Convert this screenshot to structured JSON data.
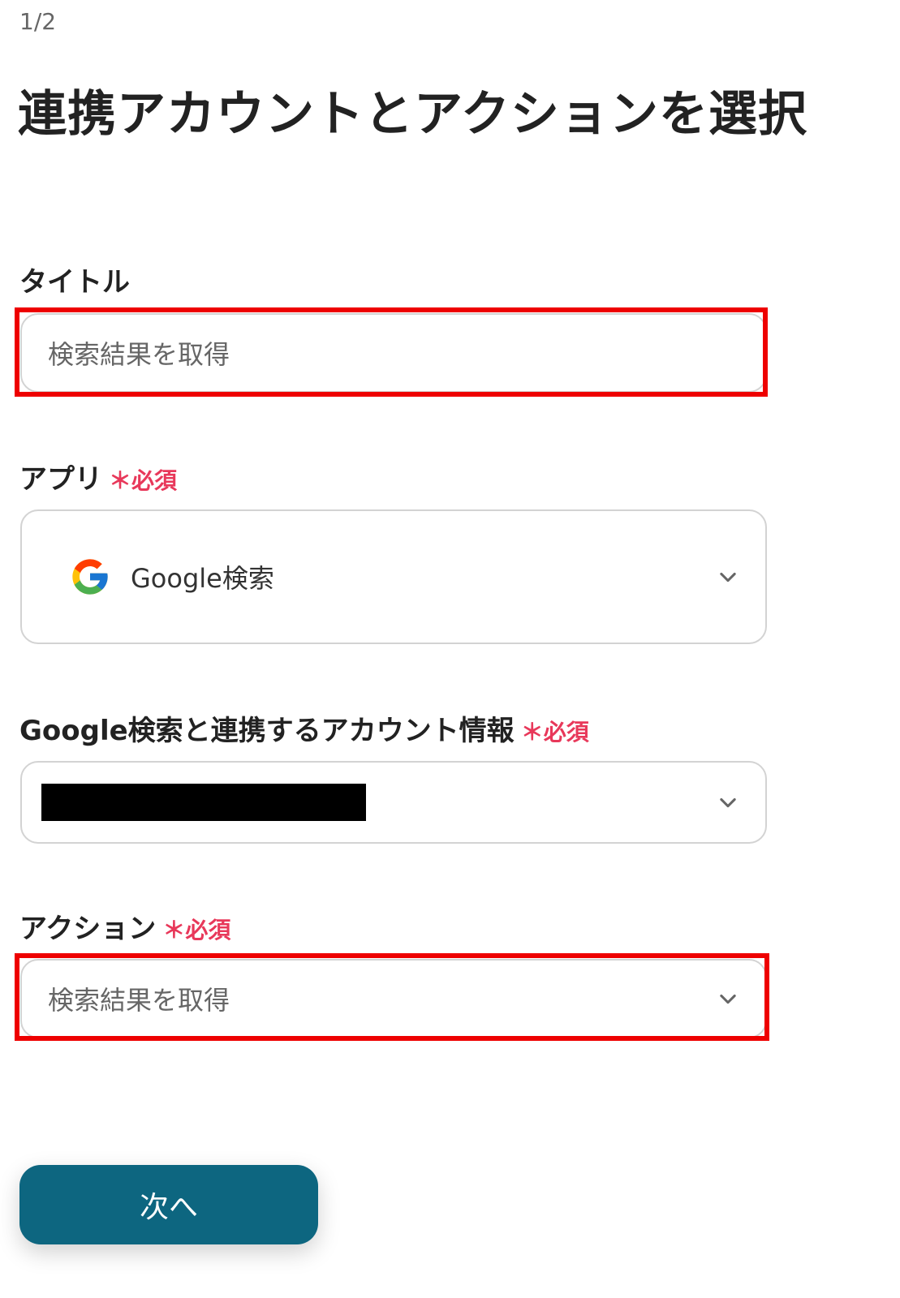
{
  "step": "1/2",
  "page_title": "連携アカウントとアクションを選択",
  "required_mark": "＊",
  "required_text": "必須",
  "fields": {
    "title": {
      "label": "タイトル",
      "value": "検索結果を取得"
    },
    "app": {
      "label": "アプリ",
      "value": "Google検索",
      "icon": "google-icon"
    },
    "account": {
      "label": "Google検索と連携するアカウント情報",
      "value": ""
    },
    "action": {
      "label": "アクション",
      "value": "検索結果を取得"
    }
  },
  "next_button_label": "次へ",
  "colors": {
    "primary": "#0d6680",
    "required": "#e8385a",
    "highlight": "#ee0000",
    "field_border": "#d3d3d3"
  }
}
